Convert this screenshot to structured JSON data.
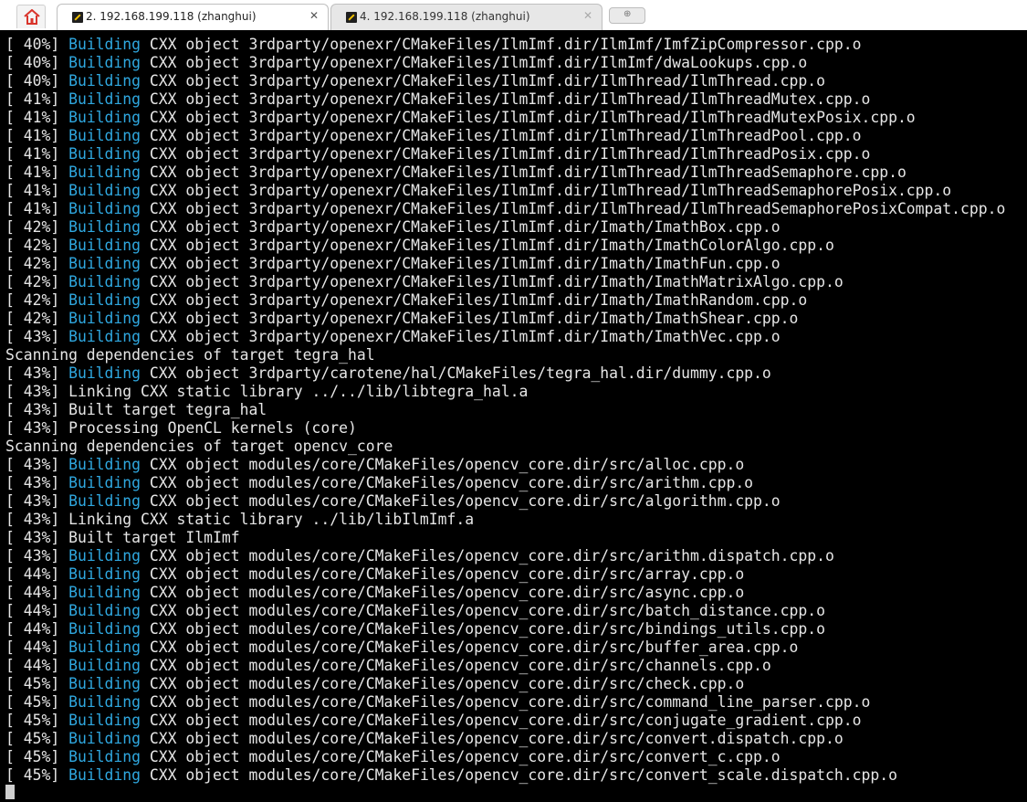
{
  "tabs": [
    {
      "label": "2. 192.168.199.118 (zhanghui)",
      "active": true,
      "close": "✕"
    },
    {
      "label": "4. 192.168.199.118 (zhanghui)",
      "active": false,
      "close": "✕"
    }
  ],
  "terminal": {
    "lines": [
      {
        "pct": "[ 40%] ",
        "kw": "Building",
        "rest": " CXX object 3rdparty/openexr/CMakeFiles/IlmImf.dir/IlmImf/ImfZipCompressor.cpp.o"
      },
      {
        "pct": "[ 40%] ",
        "kw": "Building",
        "rest": " CXX object 3rdparty/openexr/CMakeFiles/IlmImf.dir/IlmImf/dwaLookups.cpp.o"
      },
      {
        "pct": "[ 40%] ",
        "kw": "Building",
        "rest": " CXX object 3rdparty/openexr/CMakeFiles/IlmImf.dir/IlmThread/IlmThread.cpp.o"
      },
      {
        "pct": "[ 41%] ",
        "kw": "Building",
        "rest": " CXX object 3rdparty/openexr/CMakeFiles/IlmImf.dir/IlmThread/IlmThreadMutex.cpp.o"
      },
      {
        "pct": "[ 41%] ",
        "kw": "Building",
        "rest": " CXX object 3rdparty/openexr/CMakeFiles/IlmImf.dir/IlmThread/IlmThreadMutexPosix.cpp.o"
      },
      {
        "pct": "[ 41%] ",
        "kw": "Building",
        "rest": " CXX object 3rdparty/openexr/CMakeFiles/IlmImf.dir/IlmThread/IlmThreadPool.cpp.o"
      },
      {
        "pct": "[ 41%] ",
        "kw": "Building",
        "rest": " CXX object 3rdparty/openexr/CMakeFiles/IlmImf.dir/IlmThread/IlmThreadPosix.cpp.o"
      },
      {
        "pct": "[ 41%] ",
        "kw": "Building",
        "rest": " CXX object 3rdparty/openexr/CMakeFiles/IlmImf.dir/IlmThread/IlmThreadSemaphore.cpp.o"
      },
      {
        "pct": "[ 41%] ",
        "kw": "Building",
        "rest": " CXX object 3rdparty/openexr/CMakeFiles/IlmImf.dir/IlmThread/IlmThreadSemaphorePosix.cpp.o"
      },
      {
        "pct": "[ 41%] ",
        "kw": "Building",
        "rest": " CXX object 3rdparty/openexr/CMakeFiles/IlmImf.dir/IlmThread/IlmThreadSemaphorePosixCompat.cpp.o"
      },
      {
        "pct": "[ 42%] ",
        "kw": "Building",
        "rest": " CXX object 3rdparty/openexr/CMakeFiles/IlmImf.dir/Imath/ImathBox.cpp.o"
      },
      {
        "pct": "[ 42%] ",
        "kw": "Building",
        "rest": " CXX object 3rdparty/openexr/CMakeFiles/IlmImf.dir/Imath/ImathColorAlgo.cpp.o"
      },
      {
        "pct": "[ 42%] ",
        "kw": "Building",
        "rest": " CXX object 3rdparty/openexr/CMakeFiles/IlmImf.dir/Imath/ImathFun.cpp.o"
      },
      {
        "pct": "[ 42%] ",
        "kw": "Building",
        "rest": " CXX object 3rdparty/openexr/CMakeFiles/IlmImf.dir/Imath/ImathMatrixAlgo.cpp.o"
      },
      {
        "pct": "[ 42%] ",
        "kw": "Building",
        "rest": " CXX object 3rdparty/openexr/CMakeFiles/IlmImf.dir/Imath/ImathRandom.cpp.o"
      },
      {
        "pct": "[ 42%] ",
        "kw": "Building",
        "rest": " CXX object 3rdparty/openexr/CMakeFiles/IlmImf.dir/Imath/ImathShear.cpp.o"
      },
      {
        "pct": "[ 43%] ",
        "kw": "Building",
        "rest": " CXX object 3rdparty/openexr/CMakeFiles/IlmImf.dir/Imath/ImathVec.cpp.o"
      },
      {
        "pct": "",
        "kw": "",
        "rest": "Scanning dependencies of target tegra_hal"
      },
      {
        "pct": "[ 43%] ",
        "kw": "Building",
        "rest": " CXX object 3rdparty/carotene/hal/CMakeFiles/tegra_hal.dir/dummy.cpp.o"
      },
      {
        "pct": "[ 43%] ",
        "kw": "",
        "rest": "Linking CXX static library ../../lib/libtegra_hal.a"
      },
      {
        "pct": "[ 43%] ",
        "kw": "",
        "rest": "Built target tegra_hal"
      },
      {
        "pct": "[ 43%] ",
        "kw": "",
        "rest": "Processing OpenCL kernels (core)"
      },
      {
        "pct": "",
        "kw": "",
        "rest": "Scanning dependencies of target opencv_core"
      },
      {
        "pct": "[ 43%] ",
        "kw": "Building",
        "rest": " CXX object modules/core/CMakeFiles/opencv_core.dir/src/alloc.cpp.o"
      },
      {
        "pct": "[ 43%] ",
        "kw": "Building",
        "rest": " CXX object modules/core/CMakeFiles/opencv_core.dir/src/arithm.cpp.o"
      },
      {
        "pct": "[ 43%] ",
        "kw": "Building",
        "rest": " CXX object modules/core/CMakeFiles/opencv_core.dir/src/algorithm.cpp.o"
      },
      {
        "pct": "[ 43%] ",
        "kw": "",
        "rest": "Linking CXX static library ../lib/libIlmImf.a"
      },
      {
        "pct": "[ 43%] ",
        "kw": "",
        "rest": "Built target IlmImf"
      },
      {
        "pct": "[ 43%] ",
        "kw": "Building",
        "rest": " CXX object modules/core/CMakeFiles/opencv_core.dir/src/arithm.dispatch.cpp.o"
      },
      {
        "pct": "[ 44%] ",
        "kw": "Building",
        "rest": " CXX object modules/core/CMakeFiles/opencv_core.dir/src/array.cpp.o"
      },
      {
        "pct": "[ 44%] ",
        "kw": "Building",
        "rest": " CXX object modules/core/CMakeFiles/opencv_core.dir/src/async.cpp.o"
      },
      {
        "pct": "[ 44%] ",
        "kw": "Building",
        "rest": " CXX object modules/core/CMakeFiles/opencv_core.dir/src/batch_distance.cpp.o"
      },
      {
        "pct": "[ 44%] ",
        "kw": "Building",
        "rest": " CXX object modules/core/CMakeFiles/opencv_core.dir/src/bindings_utils.cpp.o"
      },
      {
        "pct": "[ 44%] ",
        "kw": "Building",
        "rest": " CXX object modules/core/CMakeFiles/opencv_core.dir/src/buffer_area.cpp.o"
      },
      {
        "pct": "[ 44%] ",
        "kw": "Building",
        "rest": " CXX object modules/core/CMakeFiles/opencv_core.dir/src/channels.cpp.o"
      },
      {
        "pct": "[ 45%] ",
        "kw": "Building",
        "rest": " CXX object modules/core/CMakeFiles/opencv_core.dir/src/check.cpp.o"
      },
      {
        "pct": "[ 45%] ",
        "kw": "Building",
        "rest": " CXX object modules/core/CMakeFiles/opencv_core.dir/src/command_line_parser.cpp.o"
      },
      {
        "pct": "[ 45%] ",
        "kw": "Building",
        "rest": " CXX object modules/core/CMakeFiles/opencv_core.dir/src/conjugate_gradient.cpp.o"
      },
      {
        "pct": "[ 45%] ",
        "kw": "Building",
        "rest": " CXX object modules/core/CMakeFiles/opencv_core.dir/src/convert.dispatch.cpp.o"
      },
      {
        "pct": "[ 45%] ",
        "kw": "Building",
        "rest": " CXX object modules/core/CMakeFiles/opencv_core.dir/src/convert_c.cpp.o"
      },
      {
        "pct": "[ 45%] ",
        "kw": "Building",
        "rest": " CXX object modules/core/CMakeFiles/opencv_core.dir/src/convert_scale.dispatch.cpp.o"
      }
    ]
  },
  "colors": {
    "background": "#000000",
    "text": "#e6e6e6",
    "keyword": "#2fa8e0",
    "home_icon": "#d9342b"
  },
  "icons": {
    "home": "home-icon",
    "session": "session-icon",
    "close": "close-icon",
    "new_tab": "new-tab-icon"
  }
}
